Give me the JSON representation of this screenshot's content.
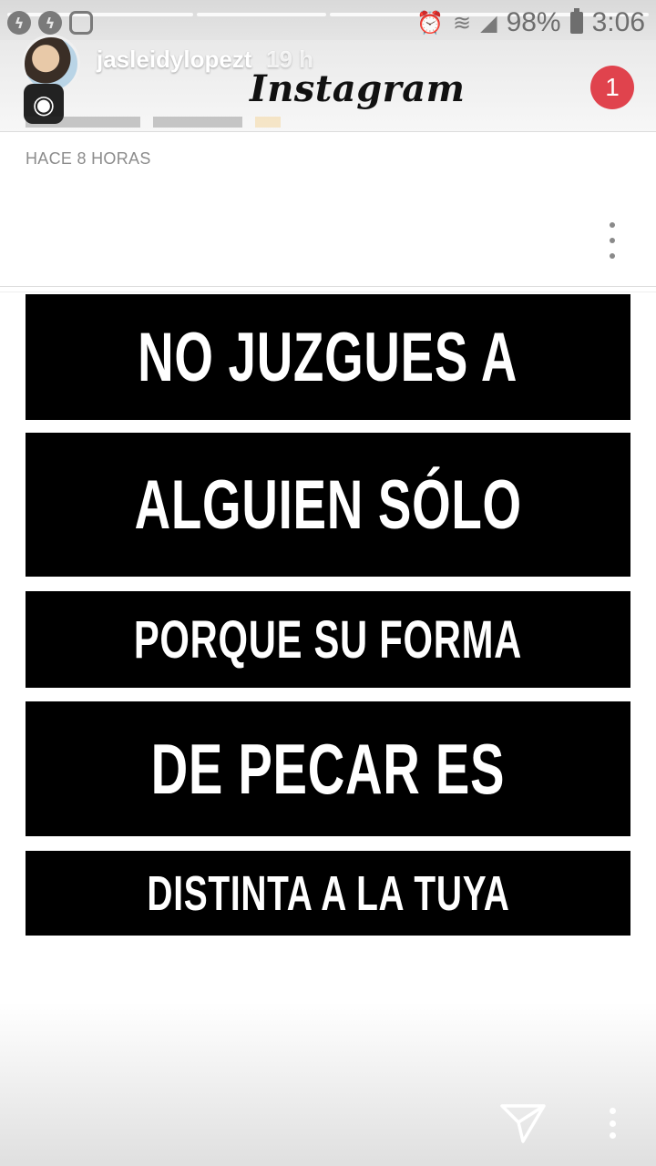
{
  "status_bar": {
    "battery": "98%",
    "time": "3:06"
  },
  "story": {
    "username": "jasleidylopezt",
    "time_ago": "19 h"
  },
  "header": {
    "logo": "Instagram",
    "notification_count": "1"
  },
  "post": {
    "time": "HACE 8 HORAS",
    "quote_lines": [
      "NO JUZGUES A",
      "ALGUIEN SÓLO",
      "PORQUE SU FORMA",
      "DE PECAR ES",
      "DISTINTA A LA TUYA"
    ]
  },
  "icons": {
    "status_left": [
      "messenger-icon",
      "messenger-icon",
      "instagram-icon"
    ],
    "status_right": [
      "alarm-icon",
      "wifi-icon",
      "signal-icon",
      "battery-icon"
    ],
    "bottom": [
      "send-icon",
      "more-options-icon"
    ]
  }
}
